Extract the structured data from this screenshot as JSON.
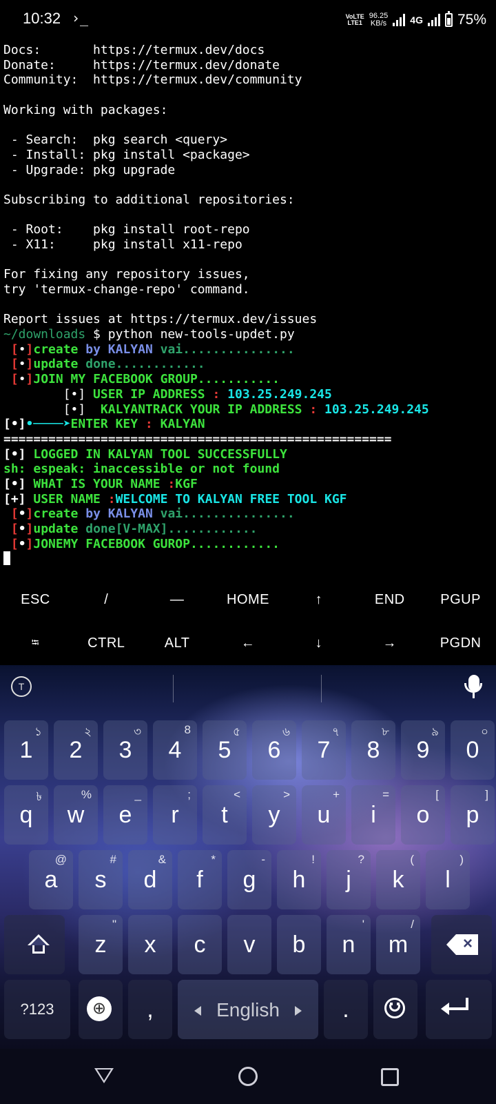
{
  "status_bar": {
    "time": "10:32",
    "terminal_indicator": "›_",
    "volte_top": "VoLTE",
    "volte_bottom": "LTE1",
    "net_speed_value": "96.25",
    "net_speed_unit": "KB/s",
    "network": "4G",
    "battery_percent": "75%",
    "battery_level": 0.75
  },
  "terminal": {
    "lines": [
      [
        {
          "t": "Docs:       https://termux.dev/docs",
          "c": "white"
        }
      ],
      [
        {
          "t": "Donate:     https://termux.dev/donate",
          "c": "white"
        }
      ],
      [
        {
          "t": "Community:  https://termux.dev/community",
          "c": "white"
        }
      ],
      [
        {
          "t": "",
          "c": "white"
        }
      ],
      [
        {
          "t": "Working with packages:",
          "c": "white"
        }
      ],
      [
        {
          "t": "",
          "c": "white"
        }
      ],
      [
        {
          "t": " - Search:  pkg search <query>",
          "c": "white"
        }
      ],
      [
        {
          "t": " - Install: pkg install <package>",
          "c": "white"
        }
      ],
      [
        {
          "t": " - Upgrade: pkg upgrade",
          "c": "white"
        }
      ],
      [
        {
          "t": "",
          "c": "white"
        }
      ],
      [
        {
          "t": "Subscribing to additional repositories:",
          "c": "white"
        }
      ],
      [
        {
          "t": "",
          "c": "white"
        }
      ],
      [
        {
          "t": " - Root:    pkg install root-repo",
          "c": "white"
        }
      ],
      [
        {
          "t": " - X11:     pkg install x11-repo",
          "c": "white"
        }
      ],
      [
        {
          "t": "",
          "c": "white"
        }
      ],
      [
        {
          "t": "For fixing any repository issues,",
          "c": "white"
        }
      ],
      [
        {
          "t": "try 'termux-change-repo' command.",
          "c": "white"
        }
      ],
      [
        {
          "t": "",
          "c": "white"
        }
      ],
      [
        {
          "t": "Report issues at https://termux.dev/issues",
          "c": "white"
        }
      ],
      [
        {
          "t": "~/downloads",
          "c": "dim"
        },
        {
          "t": " $ python new-tools-updet.py",
          "c": "white"
        }
      ],
      [
        {
          "t": " [",
          "c": "red"
        },
        {
          "t": "•",
          "c": "white"
        },
        {
          "t": "]",
          "c": "red"
        },
        {
          "t": "create",
          "c": "green"
        },
        {
          "t": " by ",
          "c": "blue"
        },
        {
          "t": "KALYAN",
          "c": "blue"
        },
        {
          "t": " vai...............",
          "c": "dim"
        }
      ],
      [
        {
          "t": " [",
          "c": "red"
        },
        {
          "t": "•",
          "c": "white"
        },
        {
          "t": "]",
          "c": "red"
        },
        {
          "t": "update",
          "c": "green"
        },
        {
          "t": " done............",
          "c": "dim"
        }
      ],
      [
        {
          "t": " [",
          "c": "red"
        },
        {
          "t": "•",
          "c": "white"
        },
        {
          "t": "]",
          "c": "red"
        },
        {
          "t": "JOIN MY FACEBOOK GROUP...........",
          "c": "green"
        }
      ],
      [
        {
          "t": "        [•]",
          "c": "white"
        },
        {
          "t": " USER IP ADDRESS ",
          "c": "green"
        },
        {
          "t": ": ",
          "c": "red"
        },
        {
          "t": "103.25.249.245",
          "c": "cyan"
        }
      ],
      [
        {
          "t": "        [•]",
          "c": "white"
        },
        {
          "t": "  KALYANTRACK YOUR IP ADDRESS ",
          "c": "green"
        },
        {
          "t": ": ",
          "c": "red"
        },
        {
          "t": "103.25.249.245",
          "c": "cyan"
        }
      ],
      [
        {
          "t": "[•]",
          "c": "white"
        },
        {
          "t": "•────➤",
          "c": "cyan"
        },
        {
          "t": "ENTER KEY ",
          "c": "green"
        },
        {
          "t": ": ",
          "c": "red"
        },
        {
          "t": "KALYAN",
          "c": "green"
        }
      ],
      [
        {
          "t": "====================================================",
          "c": "white"
        }
      ],
      [
        {
          "t": "[•]",
          "c": "white"
        },
        {
          "t": " LOGGED IN KALYAN TOOL SUCCESSFULLY",
          "c": "green"
        }
      ],
      [
        {
          "t": "sh: espeak: inaccessible or not found",
          "c": "green"
        }
      ],
      [
        {
          "t": "[•]",
          "c": "white"
        },
        {
          "t": " WHAT IS YOUR NAME ",
          "c": "green"
        },
        {
          "t": ":",
          "c": "red"
        },
        {
          "t": "KGF",
          "c": "green"
        }
      ],
      [
        {
          "t": "[+]",
          "c": "white"
        },
        {
          "t": " USER NAME ",
          "c": "green"
        },
        {
          "t": ":",
          "c": "red"
        },
        {
          "t": "WELCOME TO KALYAN FREE TOOL KGF",
          "c": "cyan"
        }
      ],
      [
        {
          "t": " [",
          "c": "red"
        },
        {
          "t": "•",
          "c": "white"
        },
        {
          "t": "]",
          "c": "red"
        },
        {
          "t": "create",
          "c": "green"
        },
        {
          "t": " by ",
          "c": "blue"
        },
        {
          "t": "KALYAN",
          "c": "blue"
        },
        {
          "t": " vai...............",
          "c": "dim"
        }
      ],
      [
        {
          "t": " [",
          "c": "red"
        },
        {
          "t": "•",
          "c": "white"
        },
        {
          "t": "]",
          "c": "red"
        },
        {
          "t": "update",
          "c": "green"
        },
        {
          "t": " done[V-MAX]............",
          "c": "dim"
        }
      ],
      [
        {
          "t": " [",
          "c": "red"
        },
        {
          "t": "•",
          "c": "white"
        },
        {
          "t": "]",
          "c": "red"
        },
        {
          "t": "JONEMY FACEBOOK GUROP............",
          "c": "green"
        }
      ]
    ],
    "colors": {
      "white": "#ffffff",
      "red": "#e53935",
      "green": "#3de33d",
      "blue": "#7a8fe8",
      "cyan": "#19e6e6",
      "dim": "#2fa36b"
    }
  },
  "extra_keys": {
    "row1": [
      "ESC",
      "/",
      "—",
      "HOME",
      "↑",
      "END",
      "PGUP"
    ],
    "row2": [
      "⭾",
      "CTRL",
      "ALT",
      "←",
      "↓",
      "→",
      "PGDN"
    ]
  },
  "keyboard": {
    "number_row": [
      {
        "k": "1",
        "s": "১"
      },
      {
        "k": "2",
        "s": "২"
      },
      {
        "k": "3",
        "s": "৩"
      },
      {
        "k": "4",
        "s": "8"
      },
      {
        "k": "5",
        "s": "৫"
      },
      {
        "k": "6",
        "s": "৬"
      },
      {
        "k": "7",
        "s": "৭"
      },
      {
        "k": "8",
        "s": "৮"
      },
      {
        "k": "9",
        "s": "৯"
      },
      {
        "k": "0",
        "s": "০"
      }
    ],
    "row_q": [
      {
        "k": "q",
        "s": "৳"
      },
      {
        "k": "w",
        "s": "%"
      },
      {
        "k": "e",
        "s": "_"
      },
      {
        "k": "r",
        "s": ";"
      },
      {
        "k": "t",
        "s": "<"
      },
      {
        "k": "y",
        "s": ">"
      },
      {
        "k": "u",
        "s": "+"
      },
      {
        "k": "i",
        "s": "="
      },
      {
        "k": "o",
        "s": "["
      },
      {
        "k": "p",
        "s": "]"
      }
    ],
    "row_a": [
      {
        "k": "a",
        "s": "@"
      },
      {
        "k": "s",
        "s": "#"
      },
      {
        "k": "d",
        "s": "&"
      },
      {
        "k": "f",
        "s": "*"
      },
      {
        "k": "g",
        "s": "-"
      },
      {
        "k": "h",
        "s": "!"
      },
      {
        "k": "j",
        "s": "?"
      },
      {
        "k": "k",
        "s": "("
      },
      {
        "k": "l",
        "s": ")"
      }
    ],
    "row_z": [
      {
        "k": "z",
        "s": "\""
      },
      {
        "k": "x",
        "s": ""
      },
      {
        "k": "c",
        "s": ""
      },
      {
        "k": "v",
        "s": ""
      },
      {
        "k": "b",
        "s": ""
      },
      {
        "k": "n",
        "s": "'"
      },
      {
        "k": "m",
        "s": "/"
      }
    ],
    "symbols_label": "?123",
    "comma": ",",
    "space_label": "English",
    "period": "."
  }
}
